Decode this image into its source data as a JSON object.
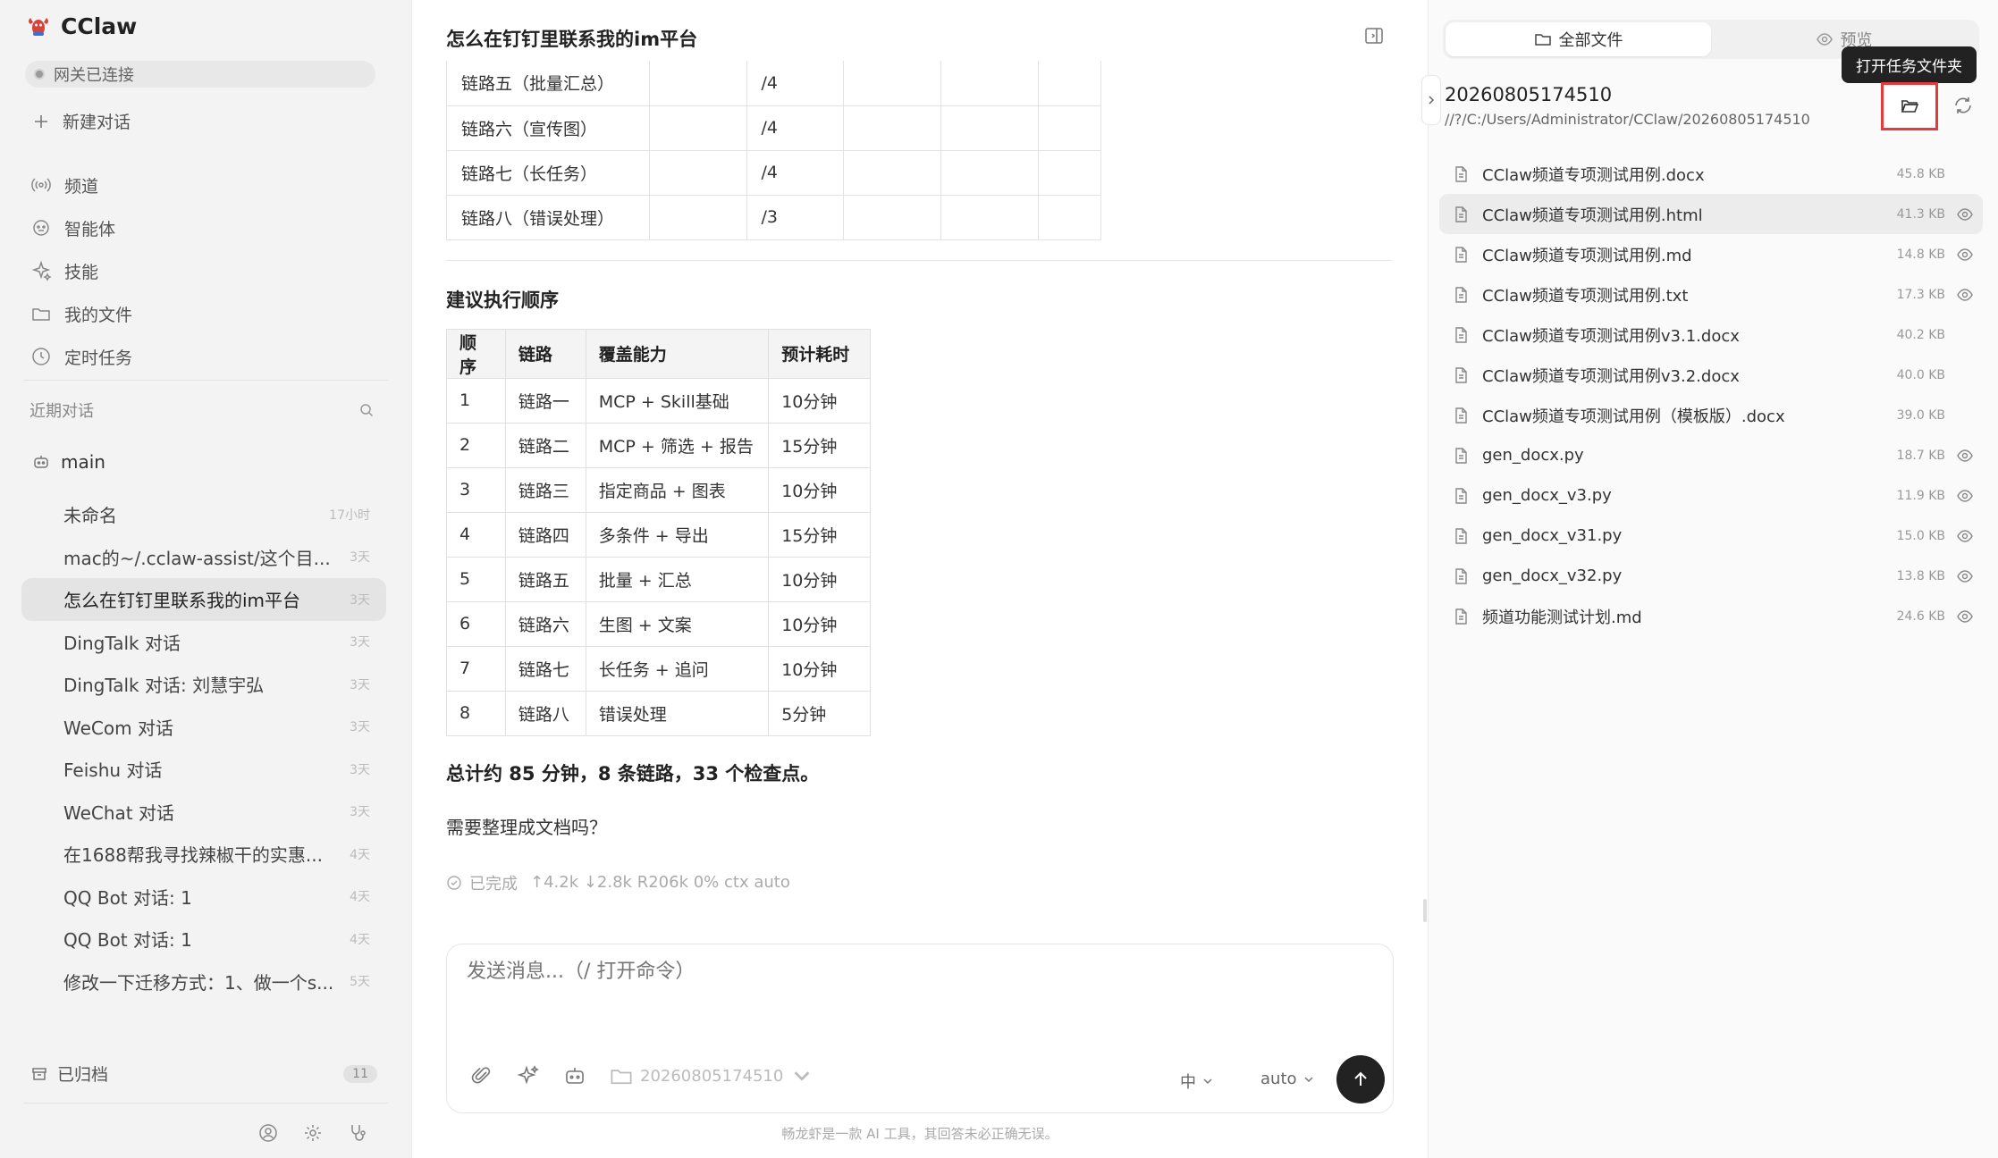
{
  "app": {
    "name": "CClaw"
  },
  "sidebar": {
    "gateway_status": "网关已连接",
    "new_chat": "新建对话",
    "nav": [
      {
        "label": "频道",
        "icon": "broadcast-icon"
      },
      {
        "label": "智能体",
        "icon": "agent-icon"
      },
      {
        "label": "技能",
        "icon": "sparkle-icon"
      },
      {
        "label": "我的文件",
        "icon": "folder-icon"
      },
      {
        "label": "定时任务",
        "icon": "clock-icon"
      }
    ],
    "recent_label": "近期对话",
    "group_label": "main",
    "conversations": [
      {
        "title": "未命名",
        "time": "17小时"
      },
      {
        "title": "mac的~/.cclaw-assist/这个目...",
        "time": "3天"
      },
      {
        "title": "怎么在钉钉里联系我的im平台",
        "time": "3天",
        "active": true
      },
      {
        "title": "DingTalk 对话",
        "time": "3天"
      },
      {
        "title": "DingTalk 对话: 刘慧宇弘",
        "time": "3天"
      },
      {
        "title": "WeCom 对话",
        "time": "3天"
      },
      {
        "title": "Feishu 对话",
        "time": "3天"
      },
      {
        "title": "WeChat 对话",
        "time": "3天"
      },
      {
        "title": "在1688帮我寻找辣椒干的实惠...",
        "time": "4天"
      },
      {
        "title": "QQ Bot 对话: 1",
        "time": "4天"
      },
      {
        "title": "QQ Bot 对话: 1",
        "time": "4天"
      },
      {
        "title": "修改一下迁移方式：1、做一个s...",
        "time": "5天"
      }
    ],
    "archived_label": "已归档",
    "archived_count": "11"
  },
  "chat": {
    "title": "怎么在钉钉里联系我的im平台",
    "table1_rows": [
      [
        "链路五（批量汇总）",
        "",
        "/4",
        "",
        "",
        ""
      ],
      [
        "链路六（宣传图）",
        "",
        "/4",
        "",
        "",
        ""
      ],
      [
        "链路七（长任务）",
        "",
        "/4",
        "",
        "",
        ""
      ],
      [
        "链路八（错误处理）",
        "",
        "/3",
        "",
        "",
        ""
      ]
    ],
    "section_title": "建议执行顺序",
    "table2_headers": [
      "顺序",
      "链路",
      "覆盖能力",
      "预计耗时"
    ],
    "table2_rows": [
      [
        "1",
        "链路一",
        "MCP + Skill基础",
        "10分钟"
      ],
      [
        "2",
        "链路二",
        "MCP + 筛选 + 报告",
        "15分钟"
      ],
      [
        "3",
        "链路三",
        "指定商品 + 图表",
        "10分钟"
      ],
      [
        "4",
        "链路四",
        "多条件 + 导出",
        "15分钟"
      ],
      [
        "5",
        "链路五",
        "批量 + 汇总",
        "10分钟"
      ],
      [
        "6",
        "链路六",
        "生图 + 文案",
        "10分钟"
      ],
      [
        "7",
        "链路七",
        "长任务 + 追问",
        "10分钟"
      ],
      [
        "8",
        "链路八",
        "错误处理",
        "5分钟"
      ]
    ],
    "summary": "总计约 85 分钟，8 条链路，33 个检查点。",
    "question": "需要整理成文档吗？",
    "status": "已完成",
    "stats": "↑4.2k ↓2.8k R206k 0% ctx auto"
  },
  "composer": {
    "placeholder": "发送消息...（/ 打开命令）",
    "folder": "20260805174510",
    "lang": "中",
    "mode": "auto",
    "disclaimer": "畅龙虾是一款 AI 工具，其回答未必正确无误。"
  },
  "files_panel": {
    "tab_all": "全部文件",
    "tab_preview": "预览",
    "tooltip": "打开任务文件夹",
    "folder_name": "20260805174510",
    "folder_path": "//?/C:/Users/Administrator/CClaw/20260805174510",
    "files": [
      {
        "name": "CClaw频道专项测试用例.docx",
        "size": "45.8 KB",
        "preview": false
      },
      {
        "name": "CClaw频道专项测试用例.html",
        "size": "41.3 KB",
        "preview": true
      },
      {
        "name": "CClaw频道专项测试用例.md",
        "size": "14.8 KB",
        "preview": true
      },
      {
        "name": "CClaw频道专项测试用例.txt",
        "size": "17.3 KB",
        "preview": true
      },
      {
        "name": "CClaw频道专项测试用例v3.1.docx",
        "size": "40.2 KB",
        "preview": false
      },
      {
        "name": "CClaw频道专项测试用例v3.2.docx",
        "size": "40.0 KB",
        "preview": false
      },
      {
        "name": "CClaw频道专项测试用例（模板版）.docx",
        "size": "39.0 KB",
        "preview": false
      },
      {
        "name": "gen_docx.py",
        "size": "18.7 KB",
        "preview": true
      },
      {
        "name": "gen_docx_v3.py",
        "size": "11.9 KB",
        "preview": true
      },
      {
        "name": "gen_docx_v31.py",
        "size": "15.0 KB",
        "preview": true
      },
      {
        "name": "gen_docx_v32.py",
        "size": "13.8 KB",
        "preview": true
      },
      {
        "name": "频道功能测试计划.md",
        "size": "24.6 KB",
        "preview": true
      }
    ]
  }
}
